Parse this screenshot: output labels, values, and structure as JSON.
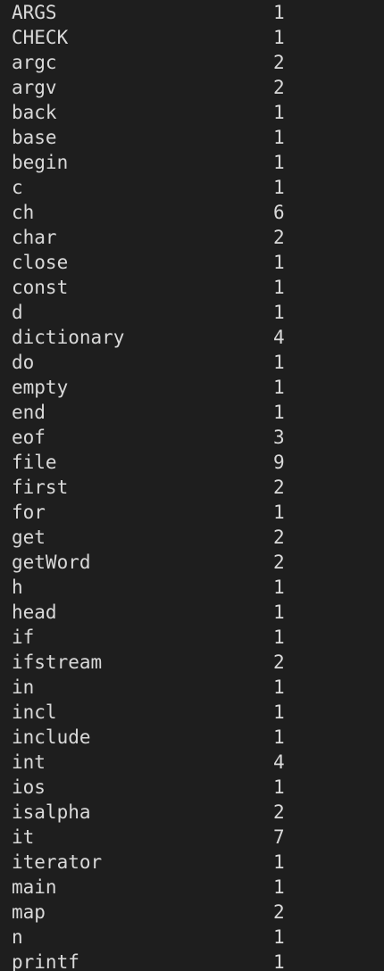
{
  "terminal": {
    "rows": [
      {
        "word": "ARGS",
        "count": "1"
      },
      {
        "word": "CHECK",
        "count": "1"
      },
      {
        "word": "argc",
        "count": "2"
      },
      {
        "word": "argv",
        "count": "2"
      },
      {
        "word": "back",
        "count": "1"
      },
      {
        "word": "base",
        "count": "1"
      },
      {
        "word": "begin",
        "count": "1"
      },
      {
        "word": "c",
        "count": "1"
      },
      {
        "word": "ch",
        "count": "6"
      },
      {
        "word": "char",
        "count": "2"
      },
      {
        "word": "close",
        "count": "1"
      },
      {
        "word": "const",
        "count": "1"
      },
      {
        "word": "d",
        "count": "1"
      },
      {
        "word": "dictionary",
        "count": "4"
      },
      {
        "word": "do",
        "count": "1"
      },
      {
        "word": "empty",
        "count": "1"
      },
      {
        "word": "end",
        "count": "1"
      },
      {
        "word": "eof",
        "count": "3"
      },
      {
        "word": "file",
        "count": "9"
      },
      {
        "word": "first",
        "count": "2"
      },
      {
        "word": "for",
        "count": "1"
      },
      {
        "word": "get",
        "count": "2"
      },
      {
        "word": "getWord",
        "count": "2"
      },
      {
        "word": "h",
        "count": "1"
      },
      {
        "word": "head",
        "count": "1"
      },
      {
        "word": "if",
        "count": "1"
      },
      {
        "word": "ifstream",
        "count": "2"
      },
      {
        "word": "in",
        "count": "1"
      },
      {
        "word": "incl",
        "count": "1"
      },
      {
        "word": "include",
        "count": "1"
      },
      {
        "word": "int",
        "count": "4"
      },
      {
        "word": "ios",
        "count": "1"
      },
      {
        "word": "isalpha",
        "count": "2"
      },
      {
        "word": "it",
        "count": "7"
      },
      {
        "word": "iterator",
        "count": "1"
      },
      {
        "word": "main",
        "count": "1"
      },
      {
        "word": "map",
        "count": "2"
      },
      {
        "word": "n",
        "count": "1"
      },
      {
        "word": "printf",
        "count": "1"
      }
    ]
  }
}
